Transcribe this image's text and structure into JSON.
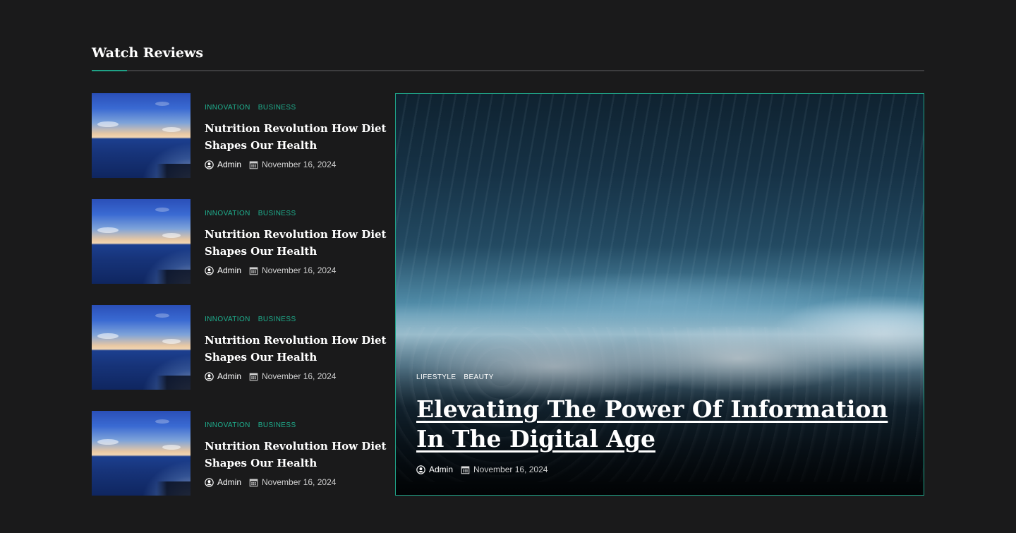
{
  "section": {
    "title": "Watch Reviews",
    "accent_color": "#1fa387"
  },
  "list_items": [
    {
      "categories": [
        "INNOVATION",
        "BUSINESS"
      ],
      "title": "Nutrition Revolution How Diet Shapes Our Health",
      "author": "Admin",
      "date": "November  16, 2024",
      "thumbnail_icon": "ocean-sunset-image"
    },
    {
      "categories": [
        "INNOVATION",
        "BUSINESS"
      ],
      "title": "Nutrition Revolution How Diet Shapes Our Health",
      "author": "Admin",
      "date": "November  16, 2024",
      "thumbnail_icon": "ocean-sunset-image"
    },
    {
      "categories": [
        "INNOVATION",
        "BUSINESS"
      ],
      "title": "Nutrition Revolution How Diet Shapes Our Health",
      "author": "Admin",
      "date": "November  16, 2024",
      "thumbnail_icon": "ocean-sunset-image"
    },
    {
      "categories": [
        "INNOVATION",
        "BUSINESS"
      ],
      "title": "Nutrition Revolution How Diet Shapes Our Health",
      "author": "Admin",
      "date": "November  16, 2024",
      "thumbnail_icon": "ocean-sunset-image"
    }
  ],
  "feature": {
    "categories": [
      "LIFESTYLE",
      "BEAUTY"
    ],
    "title": "Elevating The Power Of Information In The Digital Age",
    "author": "Admin",
    "date": "November  16, 2024",
    "image_icon": "ocean-wave-image"
  },
  "icons": {
    "author": "user-circle-icon",
    "date": "calendar-icon"
  },
  "colors": {
    "background": "#1a1a1b",
    "accent": "#1fa387",
    "category_text": "#1fb08f"
  }
}
